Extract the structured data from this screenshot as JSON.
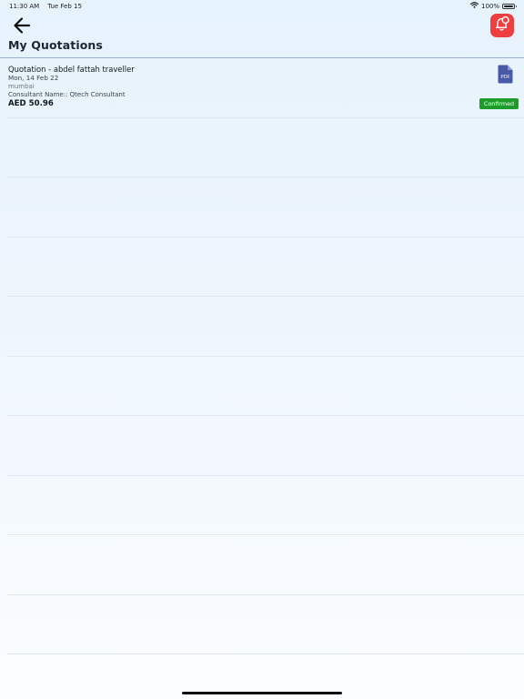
{
  "status_bar": {
    "time": "11:30 AM",
    "date": "Tue Feb 15",
    "battery": "100%",
    "battery_level": 1.0,
    "icons": [
      "wifi-icon",
      "battery-icon"
    ]
  },
  "header": {
    "title": "My Quotations",
    "back_icon": "arrow-left-icon",
    "notification_icon": "bell-icon",
    "notification_color": "#ee3e40"
  },
  "quotations": [
    {
      "title": "Quotation - abdel fattah traveller",
      "date": "Mon, 14 Feb 22",
      "city": "mumbai",
      "consultant": "Consultant Name:: Qtech Consultant",
      "amount": "AED 50.96",
      "status": "Confirmed",
      "status_color": "#1e9c2a",
      "document_icon": "pdf-file-icon",
      "document_label": "PDF"
    }
  ],
  "colors": {
    "background_top": "#e6f2fc",
    "background_bottom": "#fbfdff",
    "header_rule": "#9fb1c6",
    "pdf_icon": "#4a58a8"
  }
}
